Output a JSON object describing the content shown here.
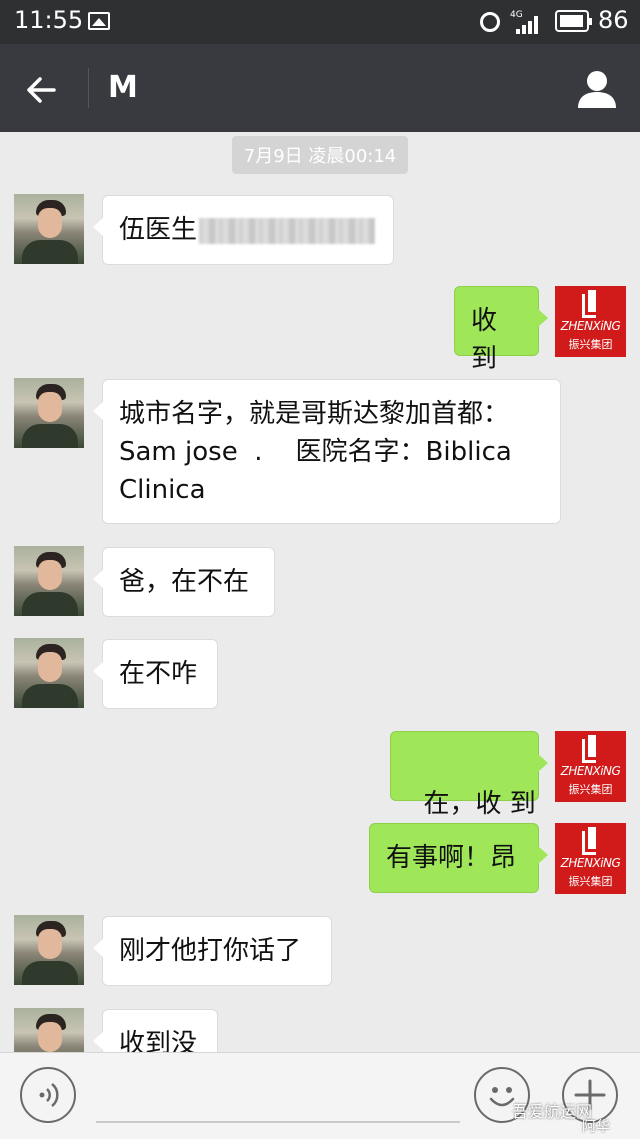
{
  "status_bar": {
    "time": "11:55",
    "network": "4G",
    "battery": "86"
  },
  "title_bar": {
    "contact_name": "M"
  },
  "chat": {
    "date_stamp": "7月9日 凌晨00:14",
    "messages": [
      {
        "side": "left",
        "text": "伍医生"
      },
      {
        "side": "right",
        "text": "收到"
      },
      {
        "side": "left",
        "lines": [
          "城市名字，就是哥斯达黎加首都：",
          "Sam jose  .    医院名字：Biblica",
          "Clinica"
        ]
      },
      {
        "side": "left",
        "text": "爸，在不在"
      },
      {
        "side": "left",
        "text": "在不咋"
      },
      {
        "side": "right",
        "text": "在，收 到"
      },
      {
        "side": "right",
        "text": "有事啊！昂"
      },
      {
        "side": "left",
        "text": "刚才他打你话了"
      },
      {
        "side": "left",
        "text": "收到没"
      }
    ]
  },
  "sender_logo": {
    "brand": "ZHENXiNG",
    "brand_cn": "振兴集团",
    "color": "#d11a1a"
  },
  "watermark": {
    "line1": "吾爱航运网",
    "line2": "阿华"
  },
  "colors": {
    "own_bubble": "#9fe658",
    "other_bubble": "#ffffff",
    "title_bar": "#393a3f",
    "status_bar": "#2f3032"
  }
}
